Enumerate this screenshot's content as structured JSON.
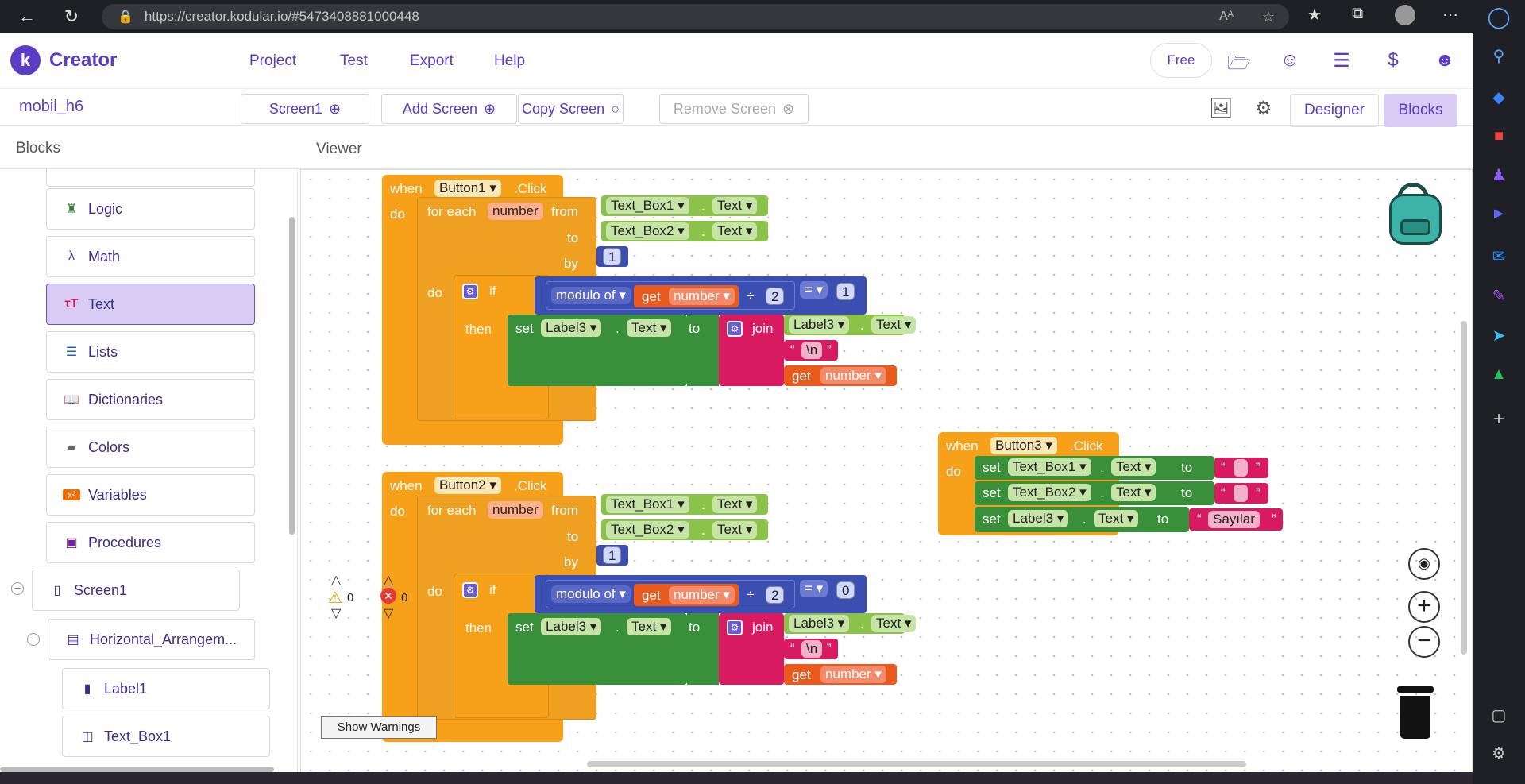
{
  "browser": {
    "url": "https://creator.kodular.io/#5473408881000448",
    "reader_label": "Aᴬ"
  },
  "app": {
    "logo_letter": "k",
    "name": "Creator",
    "menu": [
      "Project",
      "Test",
      "Export",
      "Help"
    ],
    "plan": "Free"
  },
  "toolbar": {
    "project_name": "mobil_h6",
    "screen_select": "Screen1",
    "add_screen": "Add Screen",
    "copy_screen": "Copy Screen",
    "remove_screen": "Remove Screen",
    "designer_tab": "Designer",
    "blocks_tab": "Blocks"
  },
  "panels": {
    "left_title": "Blocks",
    "viewer_title": "Viewer"
  },
  "blocks_list": [
    {
      "label": "Logic",
      "icon": "logic-icon",
      "color": "#2e7d32"
    },
    {
      "label": "Math",
      "icon": "math-icon",
      "color": "#3949ab"
    },
    {
      "label": "Text",
      "icon": "text-icon",
      "color": "#c2185b"
    },
    {
      "label": "Lists",
      "icon": "lists-icon",
      "color": "#1565c0"
    },
    {
      "label": "Dictionaries",
      "icon": "dictionaries-icon",
      "color": "#303f9f"
    },
    {
      "label": "Colors",
      "icon": "colors-icon",
      "color": "#666666"
    },
    {
      "label": "Variables",
      "icon": "variables-icon",
      "color": "#ef6c00"
    },
    {
      "label": "Procedures",
      "icon": "procedures-icon",
      "color": "#7b1fa2"
    }
  ],
  "tree": {
    "screen": "Screen1",
    "arrangement": "Horizontal_Arrangem...",
    "label": "Label1",
    "textbox": "Text_Box1"
  },
  "workspace": {
    "kw_when": "when",
    "kw_do": "do",
    "kw_click": ".Click",
    "kw_for_each": "for each",
    "kw_from": "from",
    "kw_to": "to",
    "kw_by": "by",
    "kw_if": "if",
    "kw_then": "then",
    "kw_set": "set",
    "kw_join": "join",
    "kw_get": "get",
    "kw_modulo": "modulo of",
    "kw_div": "÷",
    "kw_eq": "=",
    "kw_dot": ".",
    "var_number": "number",
    "prop_text": "Text",
    "newline": "\\n",
    "comp_tb1": "Text_Box1",
    "comp_tb2": "Text_Box2",
    "comp_label3": "Label3",
    "by_value": "1",
    "divisor": "2",
    "b1": {
      "button": "Button1",
      "remainder": "1"
    },
    "b2": {
      "button": "Button2",
      "remainder": "0"
    },
    "b3": {
      "button": "Button3",
      "empty1": " ",
      "empty2": " ",
      "str": "Sayılar"
    },
    "warnings": "0",
    "errors": "0",
    "show_warnings": "Show Warnings"
  }
}
